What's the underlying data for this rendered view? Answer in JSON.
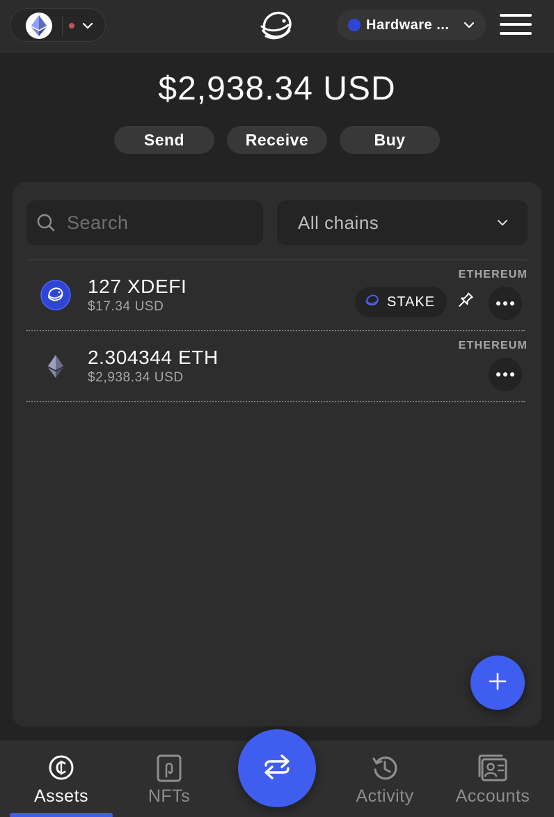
{
  "colors": {
    "accent": "#3f5ef0",
    "xdefi_blue": "#2e46d6",
    "status_dot": "#b85a57",
    "nav_active": "#ffffff",
    "nav_inactive": "#8e8e8e"
  },
  "header": {
    "network_icon": "ethereum-icon",
    "logo_icon": "xdefi-logo-icon",
    "wallet_label": "Hardware ...",
    "menu_icon": "hamburger-menu-icon"
  },
  "balance": {
    "total": "$2,938.34 USD"
  },
  "actions": {
    "send": "Send",
    "receive": "Receive",
    "buy": "Buy"
  },
  "filters": {
    "search_placeholder": "Search",
    "chain_selected": "All chains"
  },
  "assets": [
    {
      "amount": "127 XDEFI",
      "fiat": "$17.34 USD",
      "chain": "ETHEREUM",
      "icon": "xdefi-token-icon",
      "stake_label": "STAKE"
    },
    {
      "amount": "2.304344 ETH",
      "fiat": "$2,938.34 USD",
      "chain": "ETHEREUM",
      "icon": "ethereum-token-icon"
    }
  ],
  "nav": {
    "assets": "Assets",
    "nfts": "NFTs",
    "activity": "Activity",
    "accounts": "Accounts",
    "swap_icon": "swap-arrows-icon"
  }
}
